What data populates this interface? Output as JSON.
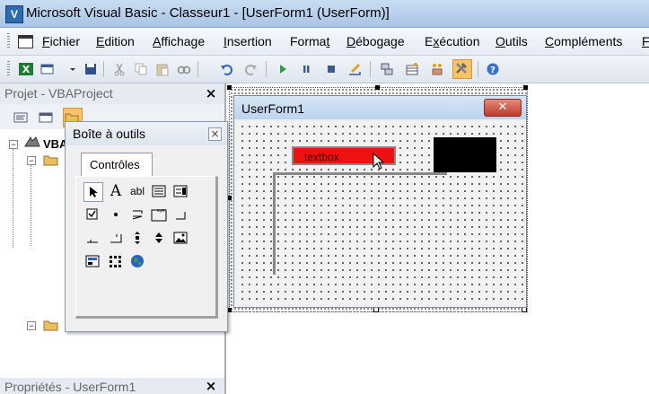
{
  "window": {
    "title": "Microsoft Visual Basic - Classeur1 - [UserForm1 (UserForm)]"
  },
  "menu": [
    {
      "label": "Fichier",
      "accel": "F",
      "rest": "ichier"
    },
    {
      "label": "Edition",
      "accel": "E",
      "rest": "dition"
    },
    {
      "label": "Affichage",
      "accel": "A",
      "rest": "ffichage"
    },
    {
      "label": "Insertion",
      "accel": "I",
      "rest": "nsertion"
    },
    {
      "label": "Format",
      "pre": "Forma",
      "accel": "t",
      "rest": ""
    },
    {
      "label": "Débogage",
      "accel": "D",
      "rest": "ébogage"
    },
    {
      "label": "Exécution",
      "pre": "E",
      "accel": "x",
      "rest": "écution"
    },
    {
      "label": "Outils",
      "accel": "O",
      "rest": "utils"
    },
    {
      "label": "Compléments",
      "accel": "C",
      "rest": "ompléments"
    },
    {
      "label": "F",
      "accel": "F",
      "rest": ""
    }
  ],
  "toolbar": {
    "icons": [
      "excel-icon",
      "insert-userform-icon",
      "save-icon",
      "cut-icon",
      "copy-icon",
      "paste-icon",
      "find-icon",
      "undo-icon",
      "redo-icon",
      "run-icon",
      "break-icon",
      "reset-icon",
      "design-mode-icon",
      "project-explorer-icon",
      "properties-icon",
      "object-browser-icon",
      "toolbox-icon",
      "help-icon"
    ]
  },
  "project_pane": {
    "title": "Projet - VBAProject",
    "close": "×",
    "tree_root": "VBA"
  },
  "properties_pane": {
    "title": "Propriétés - UserForm1",
    "close": "×"
  },
  "toolbox": {
    "title": "Boîte à outils",
    "close": "×",
    "tab": "Contrôles",
    "tools": [
      "select-objects-icon",
      "label-icon",
      "textbox-icon",
      "combobox-icon",
      "listbox-icon",
      "checkbox-icon",
      "optionbutton-icon",
      "togglebutton-icon",
      "frame-icon",
      "commandbutton-icon",
      "tabstrip-icon",
      "multipage-icon",
      "scrollbar-icon",
      "spinbutton-icon",
      "image-icon",
      "refedit-icon",
      "grid-control-icon",
      "globe-control-icon"
    ]
  },
  "userform": {
    "title": "UserForm1",
    "close": "✕",
    "textbox_text": "textbox"
  },
  "colors": {
    "textbox": "#ee1111",
    "black_control": "#000000"
  }
}
